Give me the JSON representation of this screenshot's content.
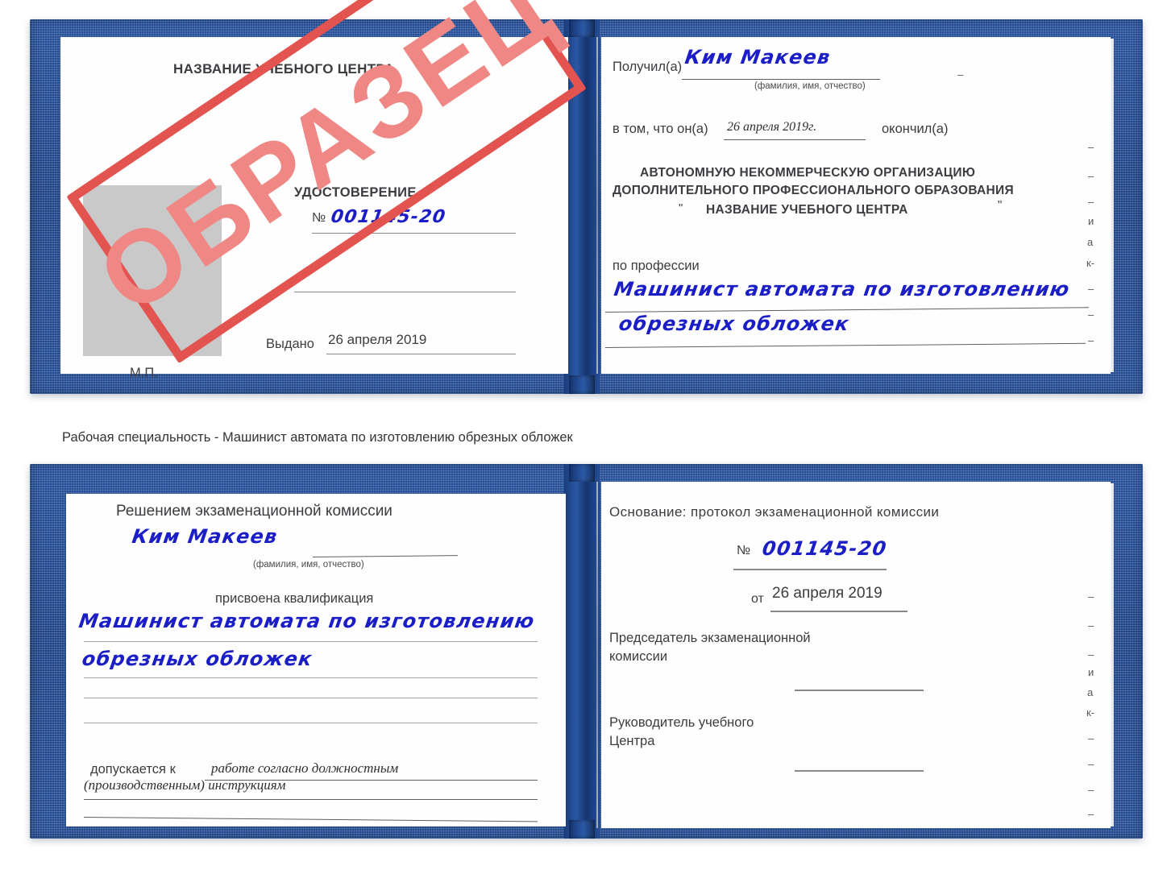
{
  "caption": "Рабочая специальность - Машинист автомата по изготовлению обрезных обложек",
  "colors": {
    "cover_blue": "#234c93",
    "stamp_red": "#e3534f",
    "stamp_text_red": "#ef8784",
    "handwriting_blue": "#1b1ec6",
    "photo_placeholder_gray": "#c9c9c9"
  },
  "stamp": {
    "label": "ОБРАЗЕЦ"
  },
  "certificate_top": {
    "left_page": {
      "center_name": "НАЗВАНИЕ УЧЕБНОГО ЦЕНТРА",
      "doc_type": "УДОСТОВЕРЕНИЕ",
      "number_label": "№",
      "number_value": "001145-20",
      "issued_label": "Выдано",
      "issued_value": "26 апреля 2019",
      "seal_label": "М.П."
    },
    "right_page": {
      "received_label": "Получил(а)",
      "received_value": "Ким Макеев",
      "received_hint": "(фамилия, имя, отчество)",
      "in_that_label": "в том, что он(а)",
      "in_that_value": "26 апреля 2019г.",
      "finished_label": "окончил(а)",
      "org_line1": "АВТОНОМНУЮ НЕКОММЕРЧЕСКУЮ ОРГАНИЗАЦИЮ",
      "org_line2": "ДОПОЛНИТЕЛЬНОГО ПРОФЕССИОНАЛЬНОГО ОБРАЗОВАНИЯ",
      "org_quote_open": "\"",
      "org_line3": "НАЗВАНИЕ УЧЕБНОГО ЦЕНТРА",
      "org_quote_close": "\"",
      "profession_label": "по профессии",
      "profession_value_line1": "Машинист автомата по изготовлению",
      "profession_value_line2": "обрезных обложек",
      "edge_fragments": [
        "–",
        "–",
        "–",
        "и",
        "а",
        "к-",
        "–",
        "–",
        "–"
      ]
    }
  },
  "certificate_bottom": {
    "left_page": {
      "decision_title": "Решением экзаменационной комиссии",
      "name_value": "Ким Макеев",
      "name_hint": "(фамилия, имя, отчество)",
      "qualification_label": "присвоена квалификация",
      "qualification_line1": "Машинист автомата по изготовлению",
      "qualification_line2": "обрезных обложек",
      "allowed_label": "допускается к",
      "allowed_value_line1": "работе согласно должностным",
      "allowed_value_line2": "(производственным) инструкциям"
    },
    "right_page": {
      "basis_label": "Основание: протокол экзаменационной комиссии",
      "number_label": "№",
      "number_value": "001145-20",
      "date_label": "от",
      "date_value": "26 апреля 2019",
      "chairman_line1": "Председатель экзаменационной",
      "chairman_line2": "комиссии",
      "head_line1": "Руководитель учебного",
      "head_line2": "Центра",
      "edge_fragments": [
        "–",
        "–",
        "–",
        "и",
        "а",
        "к-",
        "–",
        "–",
        "–",
        "–"
      ]
    }
  }
}
